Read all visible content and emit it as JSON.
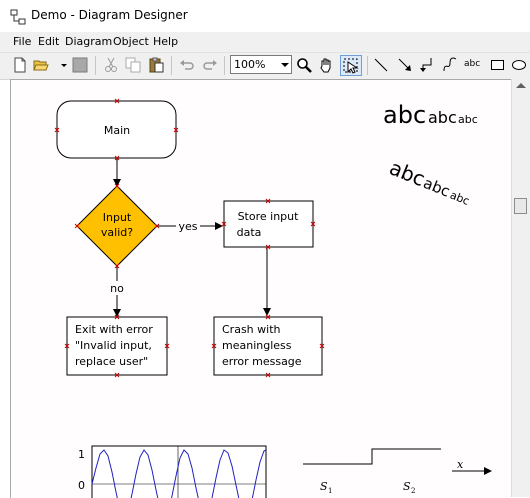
{
  "window": {
    "title": "Demo - Diagram Designer"
  },
  "menu": [
    "File",
    "Edit",
    "Diagram",
    "Object",
    "Help"
  ],
  "toolbar": {
    "zoom": "100%",
    "text_tool": "abc"
  },
  "flowchart": {
    "start": "Main",
    "decision_line1": "Input",
    "decision_line2": "valid?",
    "yes_label": "yes",
    "no_label": "no",
    "store_line1": "Store input",
    "store_line2": "data",
    "exit_line1": "Exit with error",
    "exit_line2": "\"Invalid input,",
    "exit_line3": "replace user\"",
    "crash_line1": "Crash with",
    "crash_line2": "meaningless",
    "crash_line3": "error message"
  },
  "text_samples": {
    "large": "abc",
    "medium": "abc",
    "small": "abc"
  },
  "plot": {
    "y_tick_top": "1",
    "y_tick_zero": "0"
  },
  "signal": {
    "x_label": "x",
    "s1": "S",
    "s1_sub": "1",
    "s2": "S",
    "s2_sub": "2"
  },
  "colors": {
    "decision_fill": "#ffc000",
    "handle": "#cc0000",
    "sine": "#2020c0",
    "tool_active": "#dbe9f8"
  }
}
